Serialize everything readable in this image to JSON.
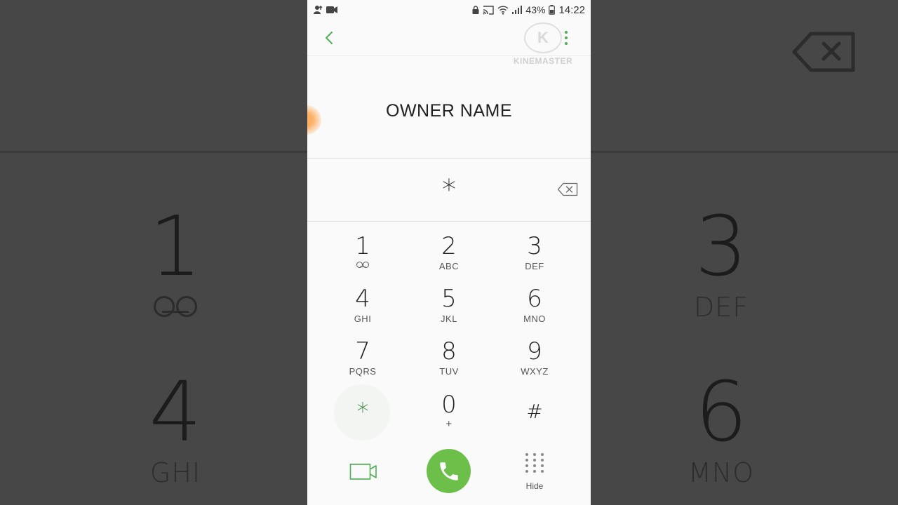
{
  "status_bar": {
    "battery_percent": "43%",
    "time": "14:22"
  },
  "watermark": {
    "logo_letter": "K",
    "text": "KINEMASTER"
  },
  "contact": {
    "name": "OWNER NAME"
  },
  "dialer": {
    "entered_number": "*",
    "keys": [
      {
        "digit": "1",
        "letters": "",
        "icon": "voicemail-icon"
      },
      {
        "digit": "2",
        "letters": "ABC"
      },
      {
        "digit": "3",
        "letters": "DEF"
      },
      {
        "digit": "4",
        "letters": "GHI"
      },
      {
        "digit": "5",
        "letters": "JKL"
      },
      {
        "digit": "6",
        "letters": "MNO"
      },
      {
        "digit": "7",
        "letters": "PQRS"
      },
      {
        "digit": "8",
        "letters": "TUV"
      },
      {
        "digit": "9",
        "letters": "WXYZ"
      },
      {
        "digit": "*",
        "letters": ""
      },
      {
        "digit": "0",
        "letters": "+"
      },
      {
        "digit": "#",
        "letters": ""
      }
    ]
  },
  "bottom_bar": {
    "hide_label": "Hide"
  },
  "background_blur": {
    "left_digit_top": "1",
    "left_digit_bottom": "4",
    "left_letters_bottom": "GHI",
    "right_digit_top": "3",
    "right_letters_top": "DEF",
    "right_digit_bottom": "6",
    "right_letters_bottom": "MNO"
  },
  "colors": {
    "accent_green": "#4caf50",
    "call_button": "#6cc04a",
    "phone_background": "#fafafa",
    "side_background": "#474747"
  }
}
